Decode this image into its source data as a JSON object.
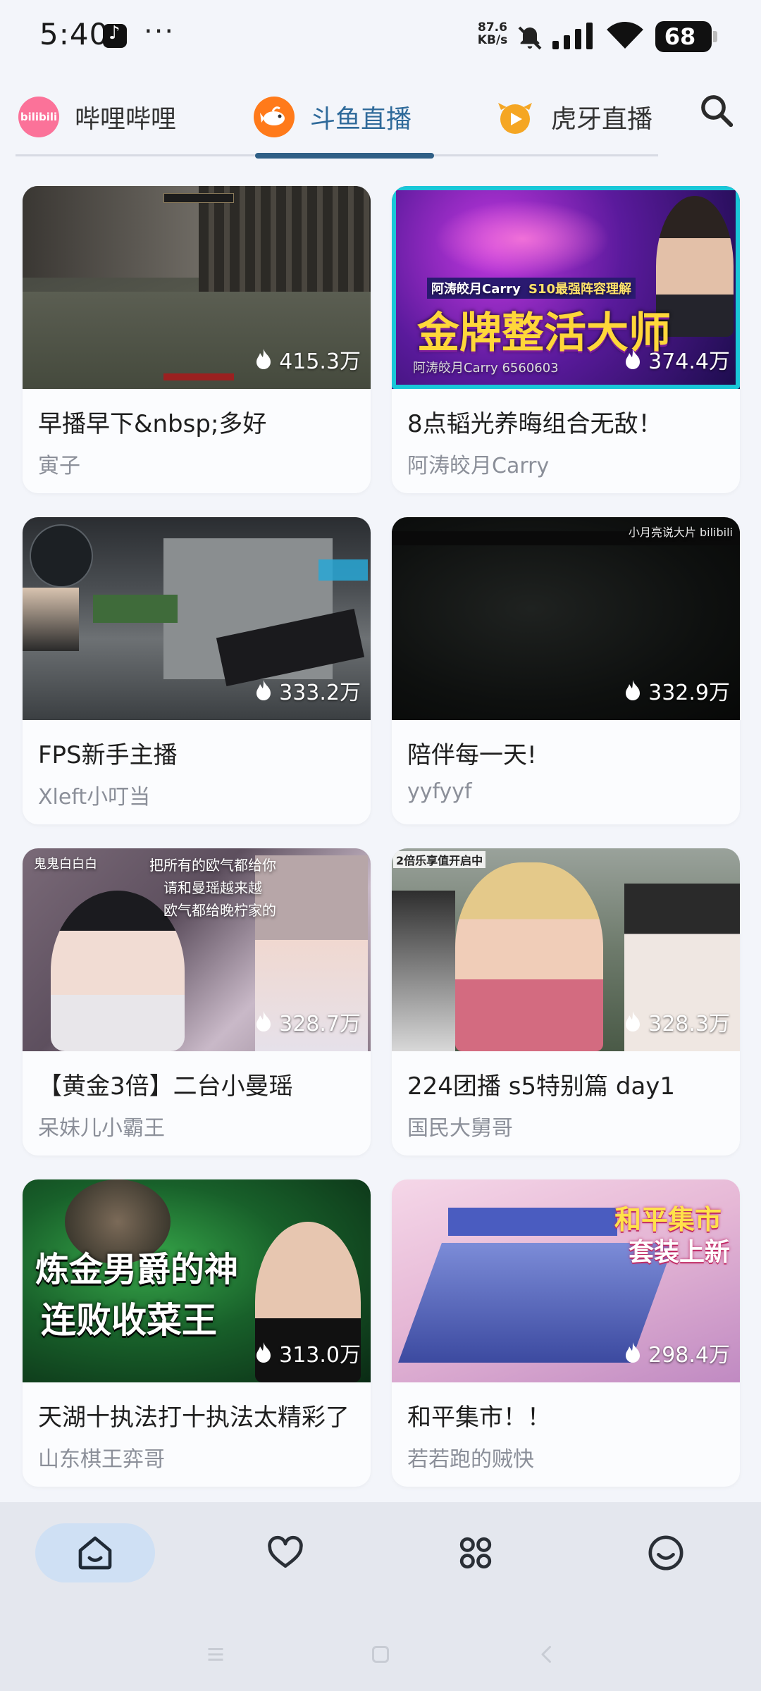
{
  "status_bar": {
    "time": "5:40",
    "dots": "···",
    "net_speed_value": "87.6",
    "net_speed_unit": "KB/s",
    "battery": "68"
  },
  "tabs": [
    {
      "label": "哔哩哔哩",
      "logo": "bilibili-logo",
      "logo_text": "bilibili",
      "active": false
    },
    {
      "label": "斗鱼直播",
      "logo": "douyu-logo",
      "active": true
    },
    {
      "label": "虎牙直播",
      "logo": "huya-logo",
      "active": false
    }
  ],
  "accent_color": "#2f6a9a",
  "rooms": [
    {
      "title": "早播早下&nbsp;多好",
      "streamer": "寅子",
      "viewers": "415.3万"
    },
    {
      "title": "8点韬光养晦组合无敌！",
      "streamer": "阿涛皎月Carry",
      "viewers": "374.4万",
      "thumb_text": {
        "headline": "金牌整活大师",
        "tag_left": "阿涛皎月Carry",
        "tag_right": "S10最强阵容理解",
        "footer": "阿涛皎月Carry 6560603"
      }
    },
    {
      "title": "FPS新手主播",
      "streamer": "Xleft小叮当",
      "viewers": "333.2万"
    },
    {
      "title": "陪伴每一天!",
      "streamer": "yyfyyf",
      "viewers": "332.9万",
      "thumb_text": {
        "corner": "小月亮说大片 bilibili"
      }
    },
    {
      "title": "【黄金3倍】二台小曼瑶",
      "streamer": "呆妹儿小霸王",
      "viewers": "328.7万",
      "thumb_text": {
        "top_left": "鬼鬼白白白",
        "top_center": "把所有的欧气都给你",
        "line2": "请和曼瑶越来越",
        "line3": "欧气都给晚柠家的"
      }
    },
    {
      "title": "224团播 s5特别篇 day1",
      "streamer": "国民大舅哥",
      "viewers": "328.3万",
      "thumb_text": {
        "top_left": "2倍乐享值开启中"
      }
    },
    {
      "title": "天湖十执法打十执法太精彩了",
      "streamer": "山东棋王弈哥",
      "viewers": "313.0万",
      "thumb_text": {
        "line1": "炼金男爵的神",
        "line2": "连败收菜王"
      }
    },
    {
      "title": "和平集市！！",
      "streamer": "若若跑的贼快",
      "viewers": "298.4万",
      "thumb_text": {
        "line1": "和平集市",
        "line2": "套装上新"
      }
    }
  ],
  "bottom_nav": [
    {
      "icon": "home-icon",
      "active": true
    },
    {
      "icon": "heart-icon",
      "active": false
    },
    {
      "icon": "apps-icon",
      "active": false
    },
    {
      "icon": "smile-icon",
      "active": false
    }
  ]
}
